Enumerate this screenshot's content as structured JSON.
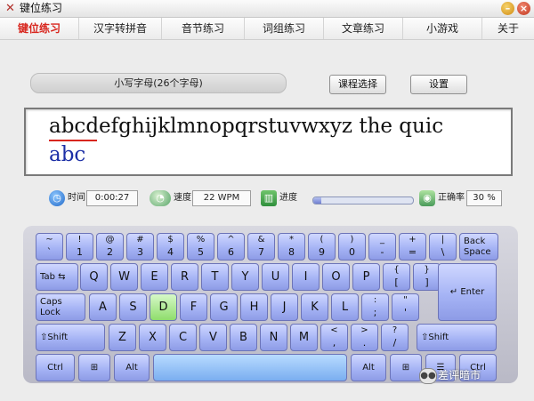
{
  "window": {
    "title": "键位练习"
  },
  "menu": [
    "键位练习",
    "汉字转拼音",
    "音节练习",
    "词组练习",
    "文章练习",
    "小游戏",
    "关于"
  ],
  "lesson": {
    "name": "小写字母(26个字母)",
    "course_button": "课程选择",
    "settings_button": "设置"
  },
  "typing": {
    "target": "abcdefghijklmnopqrstuvwxyz the quic",
    "typed": "abc"
  },
  "status": {
    "time_label": "时间",
    "time_value": "0:00:27",
    "speed_label": "速度",
    "speed_value": "22 WPM",
    "progress_label": "进度",
    "progress_fraction": 0.08,
    "accuracy_label": "正确率",
    "accuracy_value": "30 %"
  },
  "keyboard": {
    "highlight": "D",
    "row1": [
      [
        "~",
        "`"
      ],
      [
        "!",
        "1"
      ],
      [
        "@",
        "2"
      ],
      [
        "#",
        "3"
      ],
      [
        "$",
        "4"
      ],
      [
        "%",
        "5"
      ],
      [
        "^",
        "6"
      ],
      [
        "&",
        "7"
      ],
      [
        "*",
        "8"
      ],
      [
        "(",
        "9"
      ],
      [
        ")",
        "0"
      ],
      [
        "_",
        "-"
      ],
      [
        "+",
        "="
      ],
      [
        "|",
        "\\"
      ]
    ],
    "backspace": [
      "Back",
      "Space"
    ],
    "tab": "Tab",
    "row2": [
      "Q",
      "W",
      "E",
      "R",
      "T",
      "Y",
      "U",
      "I",
      "O",
      "P"
    ],
    "row2_brackets": [
      [
        "{",
        "["
      ],
      [
        "}",
        "]"
      ]
    ],
    "caps": "Caps Lock",
    "row3": [
      "A",
      "S",
      "D",
      "F",
      "G",
      "H",
      "J",
      "K",
      "L"
    ],
    "row3_punct": [
      [
        ":",
        ";"
      ],
      [
        "\"",
        "'"
      ]
    ],
    "enter": "Enter",
    "lshift": "Shift",
    "row4": [
      "Z",
      "X",
      "C",
      "V",
      "B",
      "N",
      "M"
    ],
    "row4_punct": [
      [
        "<",
        ","
      ],
      [
        ">",
        "."
      ],
      [
        "?",
        "/"
      ]
    ],
    "rshift": "Shift",
    "ctrl": "Ctrl",
    "alt": "Alt"
  },
  "watermark": "差评暗市"
}
